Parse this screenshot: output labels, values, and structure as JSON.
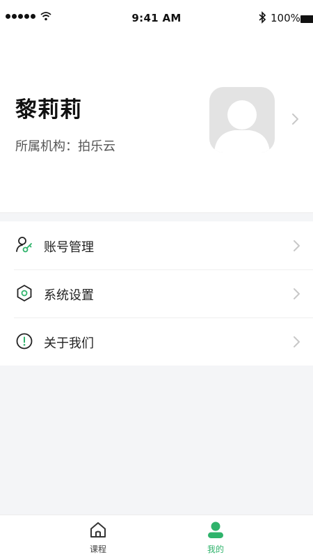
{
  "status_bar": {
    "time": "9:41 AM",
    "battery": "100%"
  },
  "profile": {
    "name": "黎莉莉",
    "org_label": "所属机构：拍乐云"
  },
  "menu": [
    {
      "label": "账号管理",
      "icon": "user-key-icon"
    },
    {
      "label": "系统设置",
      "icon": "hexagon-settings-icon"
    },
    {
      "label": "关于我们",
      "icon": "info-exclamation-icon"
    }
  ],
  "tab_bar": {
    "tabs": [
      {
        "label": "课程",
        "icon": "home-icon",
        "active": false
      },
      {
        "label": "我的",
        "icon": "user-icon",
        "active": true
      }
    ]
  },
  "colors": {
    "accent": "#2fb36b",
    "background": "#f4f5f7"
  }
}
